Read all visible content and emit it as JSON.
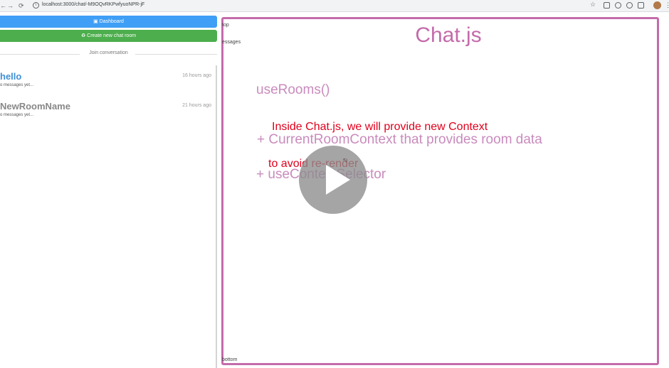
{
  "browser": {
    "back": "←",
    "forward": "→",
    "reload": "⟳",
    "url": "localhost:3000/chat/-M9OQvRKPwfyuoNPR-jF"
  },
  "sidebar": {
    "dashboard_label": "Dashboard",
    "create_room_label": "Create new chat room",
    "join_label": "Join conversation",
    "rooms": [
      {
        "name": "hello",
        "time": "16 hours ago",
        "last_message": "o messages yet...",
        "color": "#3f8fd8"
      },
      {
        "name": "NewRoomName",
        "time": "21 hours ago",
        "last_message": "o messages yet...",
        "color": "#888888"
      }
    ]
  },
  "chat": {
    "top_label": "top",
    "messages_label": "essages",
    "bottom_label": "bottom"
  },
  "slide": {
    "title": "Chat.js",
    "line1": "useRooms()",
    "line2": "+ CurrentRoomContext that provides room data",
    "line3": "+ useContextSelector",
    "note1": "Inside Chat.js, we will provide new Context",
    "note2": "to avoid re-render"
  },
  "colors": {
    "accent_pink": "#c46bab",
    "dashboard_blue": "#3f9ef5",
    "create_green": "#4cae4c",
    "note_red": "#e0001b"
  }
}
